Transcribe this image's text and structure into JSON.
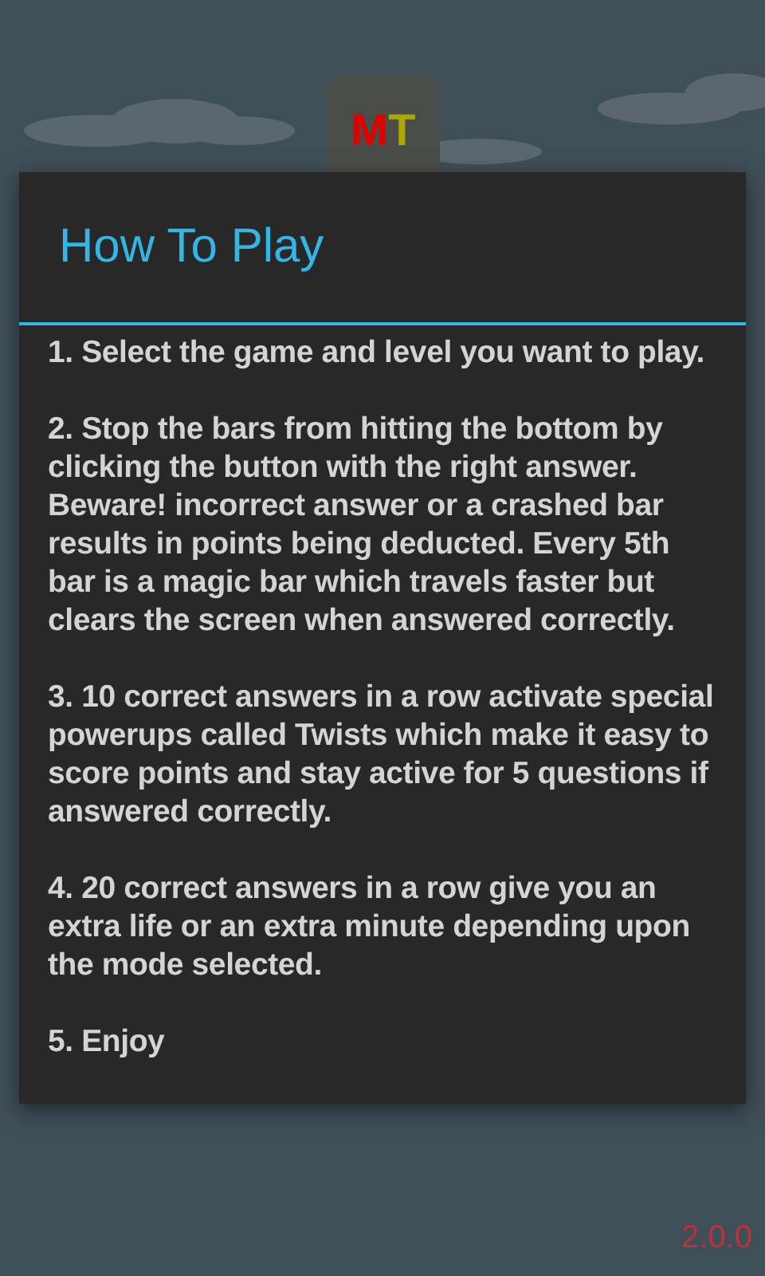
{
  "logo": {
    "letters": [
      {
        "text": "M",
        "color": "#e00000"
      },
      {
        "text": "T",
        "color": "#a8a800"
      }
    ]
  },
  "dialog": {
    "title": "How To Play",
    "paragraphs": [
      "1. Select the game and level you want to play.",
      "2. Stop the bars from hitting the bottom by clicking the button with the right answer. Beware! incorrect answer or a crashed bar results in points being deducted. Every 5th bar is a magic bar which travels faster but clears the screen when answered correctly.",
      "3. 10 correct answers in a row activate special powerups called Twists which make it easy to score points and stay active for 5 questions if answered correctly.",
      "4. 20 correct answers in a row give you an extra life or an extra minute depending upon the mode selected.",
      "5. Enjoy"
    ]
  },
  "version": "2.0.0"
}
